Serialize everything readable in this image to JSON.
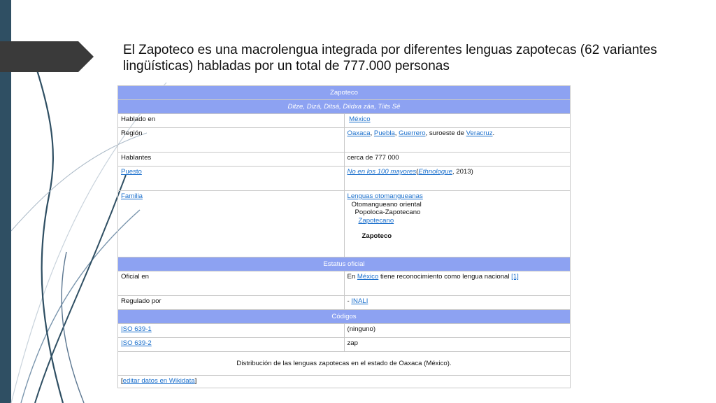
{
  "title": "El Zapoteco es una macrolengua integrada por diferentes lenguas zapotecas (62 variantes lingüísticas) habladas por un total de 777.000 personas",
  "infobox": {
    "header": "Zapoteco",
    "subheader": "Ditze, Dizá, Ditsá, Diidxa záa, Tiits Së",
    "spoken_label": "Hablado en",
    "spoken_value": "México",
    "region_label": "Región",
    "region_links": [
      "Oaxaca",
      "Puebla",
      "Guerrero"
    ],
    "region_sep1": ", ",
    "region_sep2": ", ",
    "region_mid": ", suroeste de ",
    "region_last": "Veracruz",
    "region_end": ".",
    "speakers_label": "Hablantes",
    "speakers_value": "cerca de 777 000",
    "rank_label": "Puesto",
    "rank_link": "No en los 100 mayores",
    "rank_open": "(",
    "rank_source": "Ethnologue",
    "rank_year": ", 2013)",
    "family_label": "Familia",
    "family_tree": [
      "Lenguas otomangueanas",
      "Otomangueano oriental",
      "Popoloca-Zapotecano",
      "Zapotecano",
      "Zapoteco"
    ],
    "official_header": "Estatus oficial",
    "official_label": "Oficial en",
    "official_prefix": "En ",
    "official_country": "México",
    "official_text": " tiene reconocimiento como lengua nacional ",
    "official_ref": "[1]",
    "regulated_label": "Regulado por",
    "regulated_prefix": "- ",
    "regulated_value": "INALI",
    "codes_header": "Códigos",
    "iso1_label": "ISO 639-1",
    "iso1_value": "(ninguno)",
    "iso2_label": "ISO 639-2",
    "iso2_value": "zap",
    "map_caption": "Distribución de las lenguas zapotecas en el estado de Oaxaca (México).",
    "edit_open": "[",
    "edit_link": "editar datos en Wikidata",
    "edit_close": "]"
  },
  "colors": {
    "header_bg": "#8da2f2",
    "link": "#1a6fcc",
    "left_bar": "#2f4f63",
    "arrow": "#3a3a3a"
  }
}
